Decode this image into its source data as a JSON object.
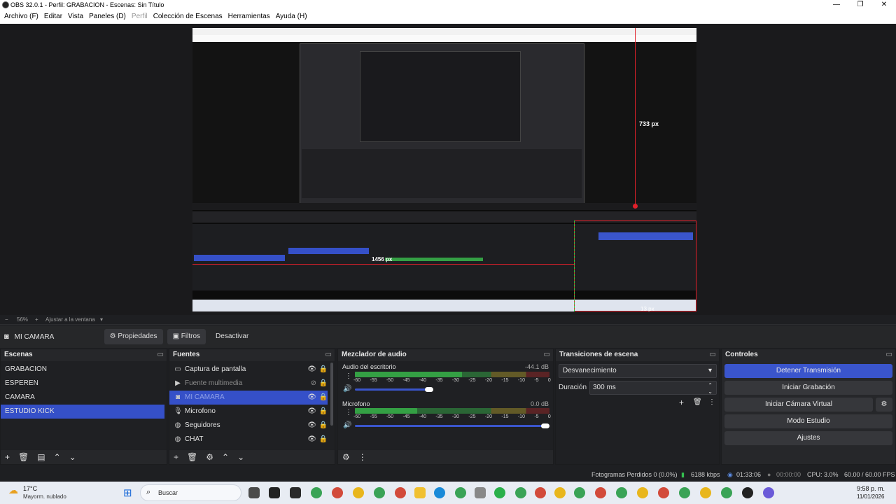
{
  "window": {
    "title": "OBS 32.0.1 - Perfil: GRABACION - Escenas: Sin Título"
  },
  "menu": [
    {
      "label": "Archivo (F)",
      "enabled": true
    },
    {
      "label": "Editar",
      "enabled": true
    },
    {
      "label": "Vista",
      "enabled": true
    },
    {
      "label": "Paneles (D)",
      "enabled": true
    },
    {
      "label": "Perfil",
      "enabled": false
    },
    {
      "label": "Colección de Escenas",
      "enabled": true
    },
    {
      "label": "Herramientas",
      "enabled": true
    },
    {
      "label": "Ayuda (H)",
      "enabled": true
    }
  ],
  "preview": {
    "measure_vertical": "733 px",
    "measure_horizontal": "1456 px",
    "measure_small": "13 px",
    "zoom": "56%",
    "fit_label": "Ajustar a la ventana"
  },
  "source_toolbar": {
    "selected_source": "MI CAMARA",
    "properties": "Propiedades",
    "filters": "Filtros",
    "deactivate": "Desactivar"
  },
  "scenes": {
    "title": "Escenas",
    "items": [
      "GRABACION",
      "ESPEREN",
      "CAMARA",
      "ESTUDIO KICK"
    ],
    "selected": "ESTUDIO KICK"
  },
  "sources": {
    "title": "Fuentes",
    "items": [
      {
        "name": "Captura de pantalla",
        "icon": "monitor-icon",
        "visible": true
      },
      {
        "name": "Fuente multimedia",
        "icon": "play-icon",
        "visible": false
      },
      {
        "name": "MI CAMARA",
        "icon": "camera-icon",
        "visible": true,
        "selected": true
      },
      {
        "name": "Microfono",
        "icon": "microphone-icon",
        "visible": true
      },
      {
        "name": "Seguidores",
        "icon": "globe-icon",
        "visible": true
      },
      {
        "name": "CHAT",
        "icon": "globe-icon",
        "visible": true
      }
    ]
  },
  "mixer": {
    "title": "Mezclador de audio",
    "channels": [
      {
        "name": "Audio del escritorio",
        "db": "-44.1 dB",
        "level": 0.55,
        "volume": 0.38
      },
      {
        "name": "Microfono",
        "db": "0.0 dB",
        "level": 0.32,
        "volume": 1.0
      }
    ],
    "ticks": [
      "-60",
      "-55",
      "-50",
      "-45",
      "-40",
      "-35",
      "-30",
      "-25",
      "-20",
      "-15",
      "-10",
      "-5",
      "0"
    ]
  },
  "transitions": {
    "title": "Transiciones de escena",
    "selected": "Desvanecimiento",
    "duration_label": "Duración",
    "duration_value": "300 ms"
  },
  "controls": {
    "title": "Controles",
    "buttons": [
      "Detener Transmisión",
      "Iniciar Grabación",
      "Iniciar Cámara Virtual",
      "Modo Estudio",
      "Ajustes"
    ]
  },
  "status": {
    "dropped": "Fotogramas Perdidos 0 (0.0%)",
    "bitrate": "6188 kbps",
    "stream_time": "01:33:06",
    "rec_time": "00:00:00",
    "cpu": "CPU: 3.0%",
    "fps": "60.00 / 60.00 FPS"
  },
  "taskbar": {
    "weather_temp": "17°C",
    "weather_desc": "Mayorm. nublado",
    "search": "Buscar",
    "time": "9:58 p. m.",
    "date": "11/01/2026"
  },
  "colors": {
    "accent": "#3a55cc",
    "meter_green": "#34a044",
    "meter_yellow": "#9a8a2a",
    "meter_red": "#8a2626",
    "guide_red": "#e0202a"
  }
}
